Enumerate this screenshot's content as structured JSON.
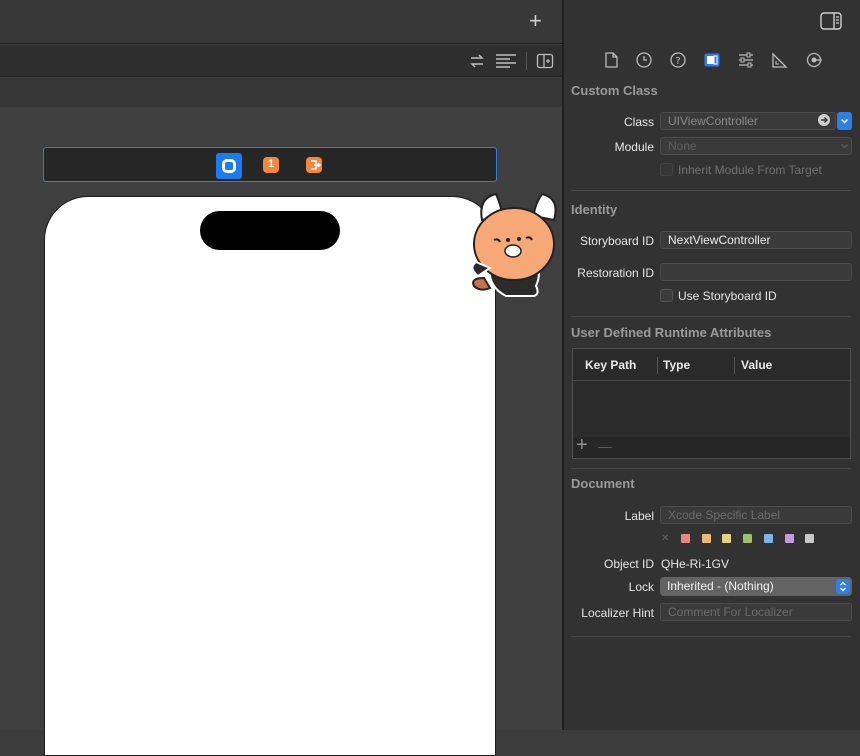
{
  "toolbar": {
    "add_label": "+"
  },
  "inspector": {
    "custom_class": {
      "title": "Custom Class",
      "class_label": "Class",
      "class_value": "UIViewController",
      "module_label": "Module",
      "module_value": "None",
      "inherit_label": "Inherit Module From Target"
    },
    "identity": {
      "title": "Identity",
      "storyboard_id_label": "Storyboard ID",
      "storyboard_id_value": "NextViewController",
      "restoration_id_label": "Restoration ID",
      "restoration_id_value": "",
      "use_storyboard_id_label": "Use Storyboard ID"
    },
    "runtime_attributes": {
      "title": "User Defined Runtime Attributes",
      "columns": [
        "Key Path",
        "Type",
        "Value"
      ],
      "add_label": "+",
      "remove_label": "—"
    },
    "document": {
      "title": "Document",
      "label_label": "Label",
      "label_placeholder": "Xcode Specific Label",
      "clear_label": "✕",
      "swatches": [
        "#e8857c",
        "#efb876",
        "#e5d27c",
        "#9cc26d",
        "#7eb4ea",
        "#c19ae0",
        "#c8c8c8"
      ],
      "object_id_label": "Object ID",
      "object_id_value": "QHe-Ri-1GV",
      "lock_label": "Lock",
      "lock_value": "Inherited - (Nothing)",
      "localizer_label": "Localizer Hint",
      "localizer_placeholder": "Comment For Localizer"
    },
    "tabs": [
      "file-icon",
      "history-icon",
      "help-icon",
      "identity-icon",
      "attributes-icon",
      "size-icon",
      "connections-icon"
    ]
  },
  "colors": {
    "accent": "#2f7ee8",
    "dock_orange": "#f0883e"
  }
}
